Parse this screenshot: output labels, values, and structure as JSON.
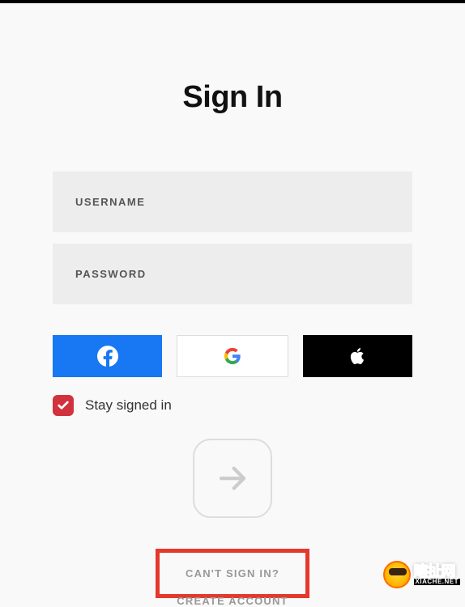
{
  "title": "Sign In",
  "fields": {
    "username_placeholder": "USERNAME",
    "password_placeholder": "PASSWORD"
  },
  "social": {
    "facebook": "facebook",
    "google": "google",
    "apple": "apple"
  },
  "checkbox": {
    "label": "Stay signed in",
    "checked": true
  },
  "links": {
    "cant_sign_in": "CAN'T SIGN IN?",
    "create_account": "CREATE ACCOUNT"
  },
  "watermark": {
    "main": "瞎扯网",
    "sub": "XIACHE.NET"
  }
}
